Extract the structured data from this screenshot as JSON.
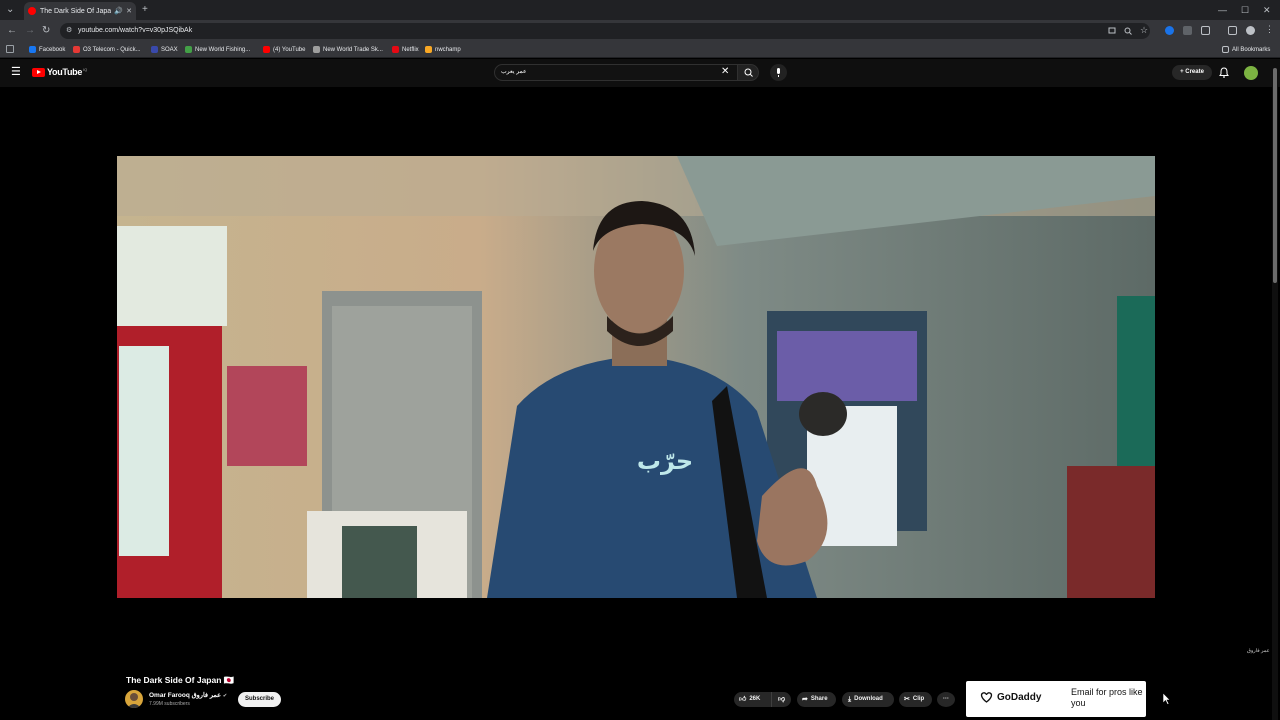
{
  "browser": {
    "tab_title": "The Dark Side Of Japan 🇯🇵",
    "url": "youtube.com/watch?v=v30pJSQibAk",
    "bookmarks": [
      {
        "label": "Facebook",
        "color": "#1877f2"
      },
      {
        "label": "O3 Telecom - Quick...",
        "color": "#e53935"
      },
      {
        "label": "SOAX",
        "color": "#3949ab"
      },
      {
        "label": "New World Fishing...",
        "color": "#43a047"
      },
      {
        "label": "(4) YouTube",
        "color": "#ff0000"
      },
      {
        "label": "New World Trade Sk...",
        "color": "#9e9e9e"
      },
      {
        "label": "Netflix",
        "color": "#e50914"
      },
      {
        "label": "nwchamp",
        "color": "#f9a825"
      }
    ],
    "all_bookmarks": "All Bookmarks"
  },
  "youtube": {
    "logo_text": "YouTube",
    "logo_country": "IQ",
    "search_value": "عمر يعرب",
    "create_label": "Create",
    "accent": "#ff0000"
  },
  "video": {
    "shirt_text": "حرّب",
    "watermark": "عمر فاروق"
  },
  "meta": {
    "title": "The Dark Side Of Japan 🇯🇵",
    "channel_name": "Omar Farooq عمر فاروق",
    "subscribers": "7.99M subscribers",
    "subscribe_label": "Subscribe",
    "likes": "26K",
    "share_label": "Share",
    "download_label": "Download",
    "clip_label": "Clip",
    "more_label": "···"
  },
  "ad": {
    "brand": "GoDaddy",
    "text": "Email for pros like you"
  }
}
